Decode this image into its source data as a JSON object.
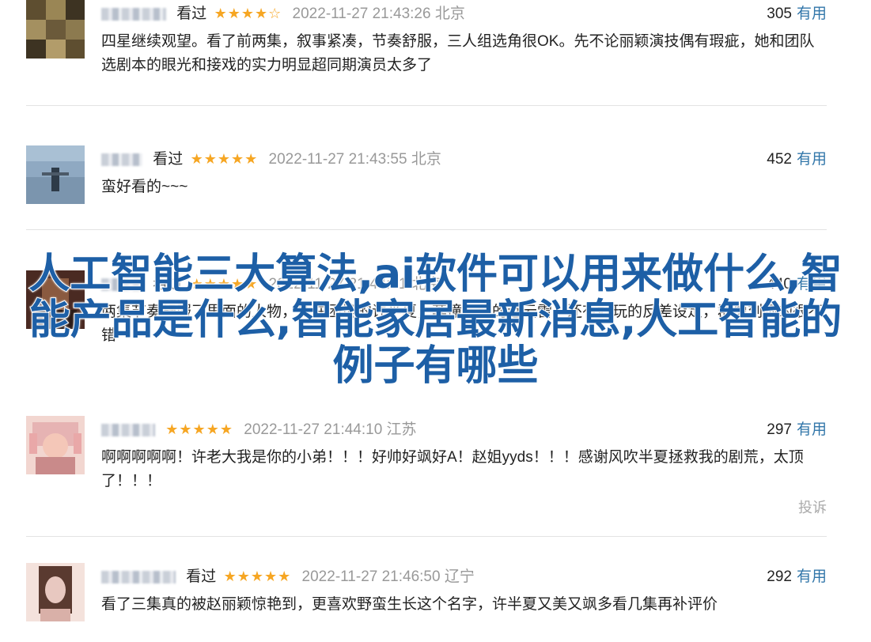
{
  "reviews": [
    {
      "seen_label": "看过",
      "stars": "★★★★☆",
      "time_loc": "2022-11-27 21:43:26 北京",
      "useful_count": "305",
      "useful_label": "有用",
      "content": "四星继续观望。看了前两集，叙事紧凑，节奏舒服，三人组选角很OK。先不论丽颖演技偶有瑕疵，她和团队选剧本的眼光和接戏的实力明显超同期演员太多了",
      "avatar_colors": [
        "#6b5a3a",
        "#8c7a4f",
        "#3d3322"
      ]
    },
    {
      "seen_label": "看过",
      "stars": "★★★★★",
      "time_loc": "2022-11-27 21:43:55 北京",
      "useful_count": "452",
      "useful_label": "有用",
      "content": "蛮好看的~~~",
      "avatar_colors": [
        "#9fb9cf",
        "#6e8aa6",
        "#c8d6e2"
      ]
    },
    {
      "seen_label": "看过",
      "stars": "★★★★★",
      "time_loc": "2022-11-27 21:44:31 北京",
      "useful_count": "440",
      "useful_label": "有用",
      "content": "两集节奏舒服了里面的人物，处在困境的许半夏，莽撞新颖的赵云雷，还有好玩的反差设定，群像刻画的很不错",
      "avatar_colors": [
        "#4a2a22",
        "#8a5a40",
        "#2a1a16"
      ]
    },
    {
      "seen_label": "",
      "stars": "★★★★★",
      "time_loc": "2022-11-27 21:44:10 江苏",
      "useful_count": "297",
      "useful_label": "有用",
      "content": "啊啊啊啊啊！许老大我是你的小弟！！！好帅好飒好A！赵姐yyds！！！感谢风吹半夏拯救我的剧荒，太顶了！！！",
      "report_label": "投诉",
      "avatar_colors": [
        "#e6b3b3",
        "#c98a8a",
        "#f2d6d0"
      ]
    },
    {
      "seen_label": "看过",
      "stars": "★★★★★",
      "time_loc": "2022-11-27 21:46:50 辽宁",
      "useful_count": "292",
      "useful_label": "有用",
      "content": "看了三集真的被赵丽颖惊艳到，更喜欢野蛮生长这个名字，许半夏又美又飒多看几集再补评价",
      "avatar_colors": [
        "#e8c8c0",
        "#5a3a30",
        "#f4e2dc"
      ]
    }
  ],
  "overlay_title": "人工智能三大算法,ai软件可以用来做什么,智能产品是什么,智能家居最新消息,人工智能的例子有哪些"
}
